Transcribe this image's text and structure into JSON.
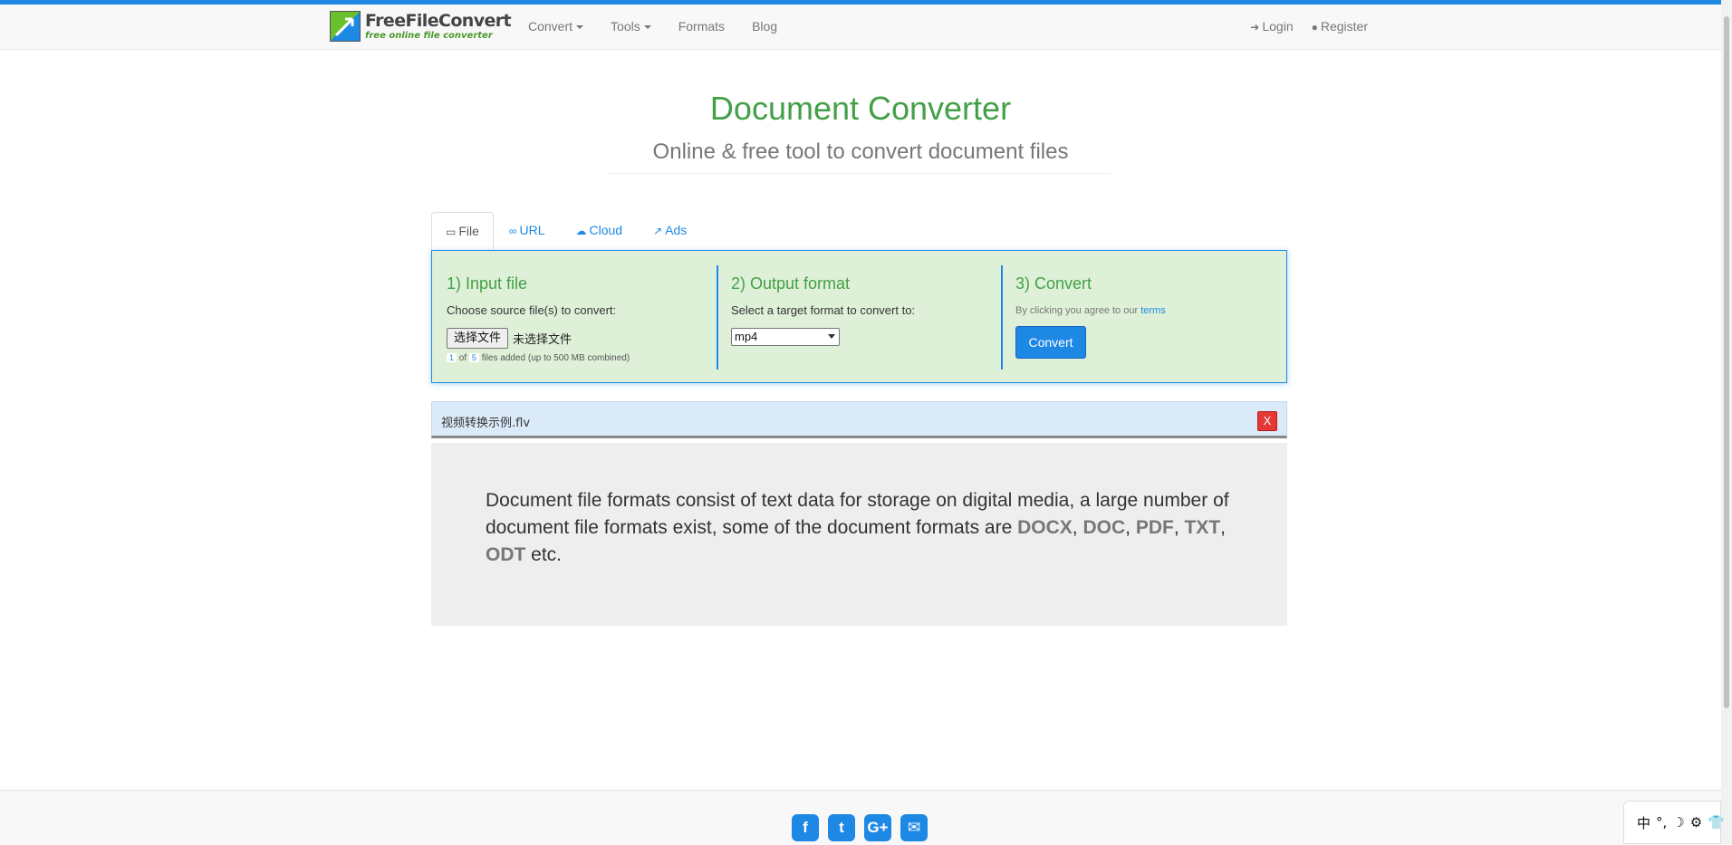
{
  "brand": {
    "name": "FreeFileConvert",
    "tagline": "free online file converter"
  },
  "nav": {
    "convert": "Convert",
    "tools": "Tools",
    "formats": "Formats",
    "blog": "Blog",
    "login": "Login",
    "register": "Register"
  },
  "hero": {
    "title": "Document Converter",
    "subtitle": "Online & free tool to convert document files"
  },
  "tabs": [
    {
      "label": "File",
      "icon": "monitor-icon",
      "active": true
    },
    {
      "label": "URL",
      "icon": "link-icon"
    },
    {
      "label": "Cloud",
      "icon": "cloud-icon"
    },
    {
      "label": "Ads",
      "icon": "external-link-icon"
    }
  ],
  "steps": {
    "input": {
      "title": "1) Input file",
      "label": "Choose source file(s) to convert:",
      "choose_button": "选择文件",
      "no_file": "未选择文件",
      "count_current": "1",
      "count_of": "of",
      "count_max": "5",
      "count_note": "files added (up to 500 MB combined)"
    },
    "output": {
      "title": "2) Output format",
      "label": "Select a target format to convert to:",
      "selected": "mp4"
    },
    "convert": {
      "title": "3) Convert",
      "terms_prefix": "By clicking you agree to our",
      "terms_link": "terms",
      "button": "Convert"
    }
  },
  "file_item": {
    "name": "视频转换示例.flv",
    "remove": "X"
  },
  "description": {
    "text": "Document file formats consist of text data for storage on digital media, a large number of document file formats exist, some of the document formats are",
    "formats": [
      "DOCX",
      "DOC",
      "PDF",
      "TXT",
      "ODT"
    ],
    "suffix": "etc."
  },
  "footer": {
    "social": [
      {
        "name": "facebook-icon",
        "glyph": "f"
      },
      {
        "name": "twitter-icon",
        "glyph": "t"
      },
      {
        "name": "google-plus-icon",
        "glyph": "G+"
      },
      {
        "name": "email-icon",
        "glyph": "✉"
      }
    ]
  },
  "ime": [
    "中",
    "°,",
    "☽",
    "⚙",
    "👕"
  ],
  "colors": {
    "accent": "#1e88e5",
    "green_title": "#43a047",
    "panel_bg": "#dff0d8",
    "file_item_bg": "#dbeaf9",
    "remove_red": "#e53935"
  }
}
